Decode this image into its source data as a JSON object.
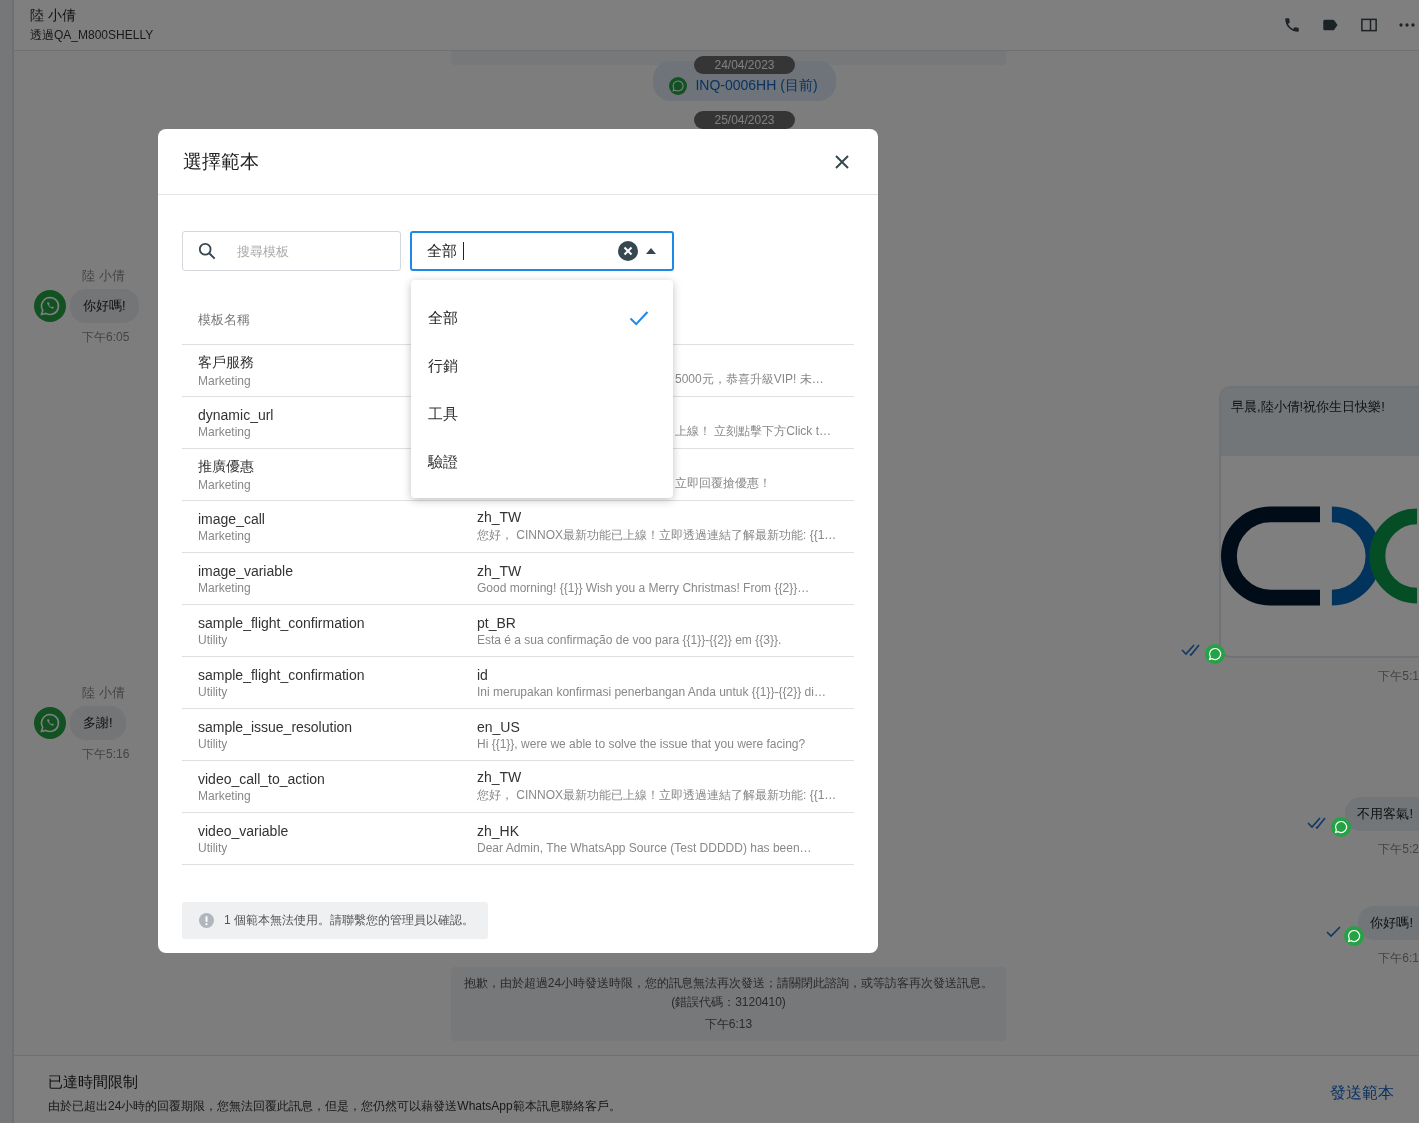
{
  "header": {
    "name": "陸 小倩",
    "subtitle": "透過QA_M800SHELLY"
  },
  "chat": {
    "date_1": "24/04/2023",
    "ticket": "INQ-0006HH (目前)",
    "date_2": "25/04/2023",
    "incoming": [
      {
        "sender": "陸 小倩",
        "text": "你好嗎!",
        "time": "下午6:05"
      },
      {
        "sender": "陸 小倩",
        "text": "多謝!",
        "time": "下午5:16"
      }
    ],
    "outgoing": [
      {
        "kind": "image",
        "text": "早晨,陸小倩!祝你生日快樂!",
        "time": "下午5:1",
        "read": true
      },
      {
        "kind": "text",
        "text": "不用客氣!",
        "time": "下午5:2",
        "read": true
      },
      {
        "kind": "text",
        "text": "你好嗎!",
        "time": "下午6:1",
        "read": false
      }
    ],
    "system_message": {
      "text": "抱歉，由於超過24小時發送時限，您的訊息無法再次發送；請關閉此諮詢，或等訪客再次發送訊息。",
      "code": "(錯誤代碼：3120410)",
      "time": "下午6:13"
    }
  },
  "footer": {
    "title": "已達時間限制",
    "text": "由於已超出24小時的回覆期限，您無法回覆此訊息，但是，您仍然可以藉發送WhatsApp範本訊息聯絡客戶。",
    "action": "發送範本"
  },
  "dialog": {
    "title": "選擇範本",
    "search": {
      "placeholder": "搜尋模板"
    },
    "category_select": {
      "value": "全部",
      "open": true,
      "options": [
        {
          "label": "全部",
          "selected": true
        },
        {
          "label": "行銷",
          "selected": false
        },
        {
          "label": "工具",
          "selected": false
        },
        {
          "label": "驗證",
          "selected": false
        }
      ]
    },
    "table": {
      "column_1": "模板名稱",
      "rows": [
        {
          "name": "客戶服務",
          "category": "Marketing",
          "preview": "5000元，恭喜升級VIP! 未…"
        },
        {
          "name": "dynamic_url",
          "category": "Marketing",
          "preview": "上線！ 立刻點擊下方Click t…"
        },
        {
          "name": "推廣優惠",
          "category": "Marketing",
          "preview": "立即回覆搶優惠！"
        },
        {
          "name": "image_call",
          "category": "Marketing",
          "language": "zh_TW",
          "preview": "您好， CINNOX最新功能已上線！立即透過連結了解最新功能: {{1…"
        },
        {
          "name": "image_variable",
          "category": "Marketing",
          "language": "zh_TW",
          "preview": "Good morning! {{1}} Wish you a Merry Christmas! From {{2}}…"
        },
        {
          "name": "sample_flight_confirmation",
          "category": "Utility",
          "language": "pt_BR",
          "preview": "Esta é a sua confirmação de voo para {{1}}-{{2}} em {{3}}."
        },
        {
          "name": "sample_flight_confirmation",
          "category": "Utility",
          "language": "id",
          "preview": "Ini merupakan konfirmasi penerbangan Anda untuk {{1}}-{{2}} di…"
        },
        {
          "name": "sample_issue_resolution",
          "category": "Utility",
          "language": "en_US",
          "preview": "Hi {{1}}, were we able to solve the issue that you were facing?"
        },
        {
          "name": "video_call_to_action",
          "category": "Marketing",
          "language": "zh_TW",
          "preview": "您好， CINNOX最新功能已上線！立即透過連結了解最新功能: {{1…"
        },
        {
          "name": "video_variable",
          "category": "Utility",
          "language": "zh_HK",
          "preview": "Dear Admin, The WhatsApp Source (Test DDDDD) has been…"
        }
      ]
    },
    "notice": "1 個範本無法使用。請聯繫您的管理員以確認。"
  }
}
